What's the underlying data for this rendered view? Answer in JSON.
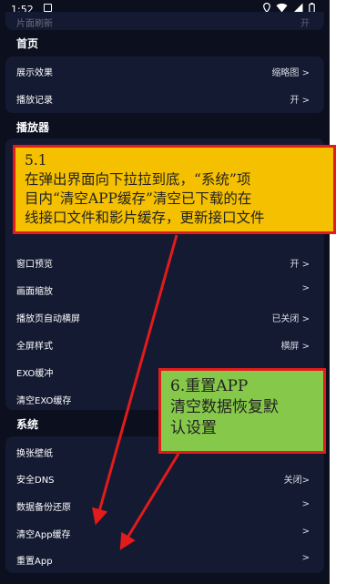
{
  "status_bar": {
    "time": "1:52"
  },
  "top_row": {
    "label": "片面刷新",
    "value": "开"
  },
  "home": {
    "title": "首页",
    "items": [
      {
        "label": "展示效果",
        "value": "缩略图 >"
      },
      {
        "label": "播放记录",
        "value": "开 >"
      }
    ]
  },
  "player": {
    "title": "播放器",
    "items": [
      {
        "label": "窗口预览",
        "value": "开 >"
      },
      {
        "label": "画面缩放",
        "value": ">"
      },
      {
        "label": "播放页自动横屏",
        "value": "已关闭 >"
      },
      {
        "label": "全屏样式",
        "value": "横屏 >"
      },
      {
        "label": "EXO缓冲",
        "value": ""
      },
      {
        "label": "清空EXO缓存",
        "value": ""
      }
    ]
  },
  "system": {
    "title": "系统",
    "items": [
      {
        "label": "换张壁纸",
        "value": ""
      },
      {
        "label": "安全DNS",
        "value": "关闭>"
      },
      {
        "label": "数据备份还原",
        "value": ">"
      },
      {
        "label": "清空App缓存",
        "value": ">"
      },
      {
        "label": "重置App",
        "value": ">"
      }
    ]
  },
  "annotations": {
    "yellow": {
      "line1": "5.1",
      "line2": "在弹出界面向下拉拉到底，“系统”项",
      "line3": "目内“清空APP缓存”清空已下载的在",
      "line4": "线接口文件和影片缓存，更新接口文件"
    },
    "green": {
      "line1": "6.重置APP",
      "line2": "清空数据恢复默",
      "line3": "认设置"
    }
  },
  "colors": {
    "background": "#0b0f1e",
    "card": "#141a32",
    "callout_yellow": "#f5c000",
    "callout_green": "#86c84a",
    "arrow_red": "#e21b1b"
  }
}
